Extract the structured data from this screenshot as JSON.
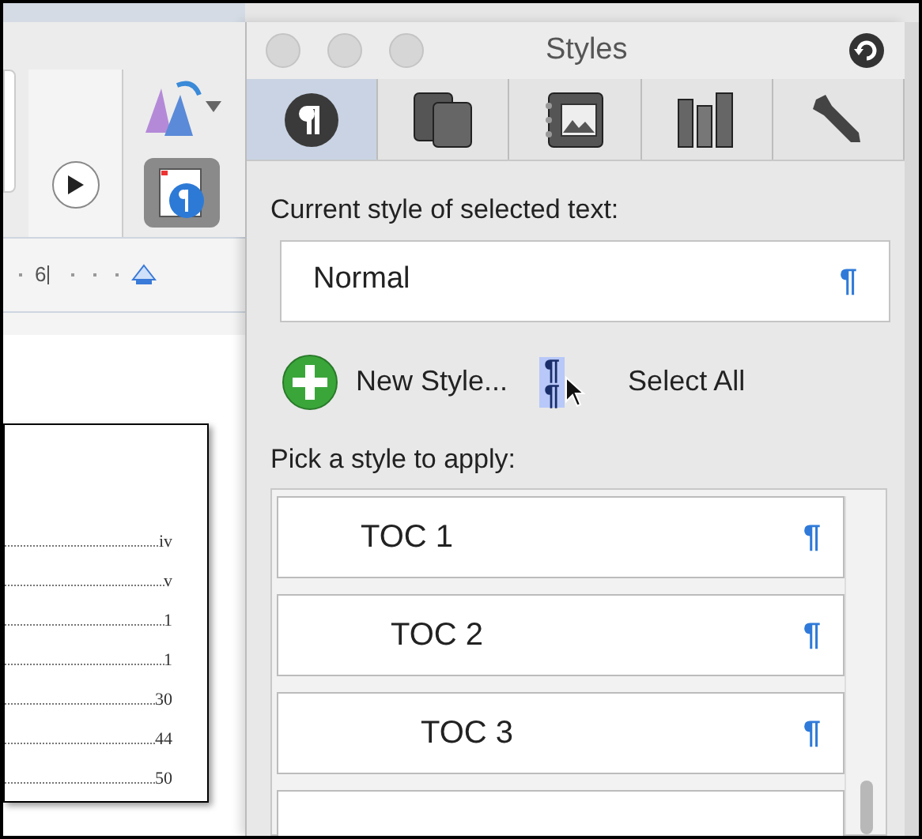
{
  "window": {
    "title": "Styles"
  },
  "tabs": [
    {
      "kind": "paragraph",
      "selected": true
    },
    {
      "kind": "copies",
      "selected": false
    },
    {
      "kind": "gallery",
      "selected": false
    },
    {
      "kind": "books",
      "selected": false
    },
    {
      "kind": "wrench",
      "selected": false
    }
  ],
  "current_style": {
    "label": "Current style of selected text:",
    "value": "Normal",
    "mark": "¶"
  },
  "actions": [
    {
      "kind": "new",
      "label": "New Style..."
    },
    {
      "kind": "select_all",
      "label": "Select All",
      "icon_marks": [
        "¶",
        "¶"
      ]
    }
  ],
  "style_list": {
    "label": "Pick a style to apply:",
    "items": [
      {
        "name": "TOC 1",
        "mark": "¶"
      },
      {
        "name": "TOC 2",
        "mark": "¶"
      },
      {
        "name": "TOC 3",
        "mark": "¶"
      }
    ]
  },
  "ruler": {
    "number": "6"
  },
  "document": {
    "toc_page_numbers": [
      "iv",
      "v",
      "1",
      "1",
      "30",
      "44",
      "50"
    ]
  }
}
